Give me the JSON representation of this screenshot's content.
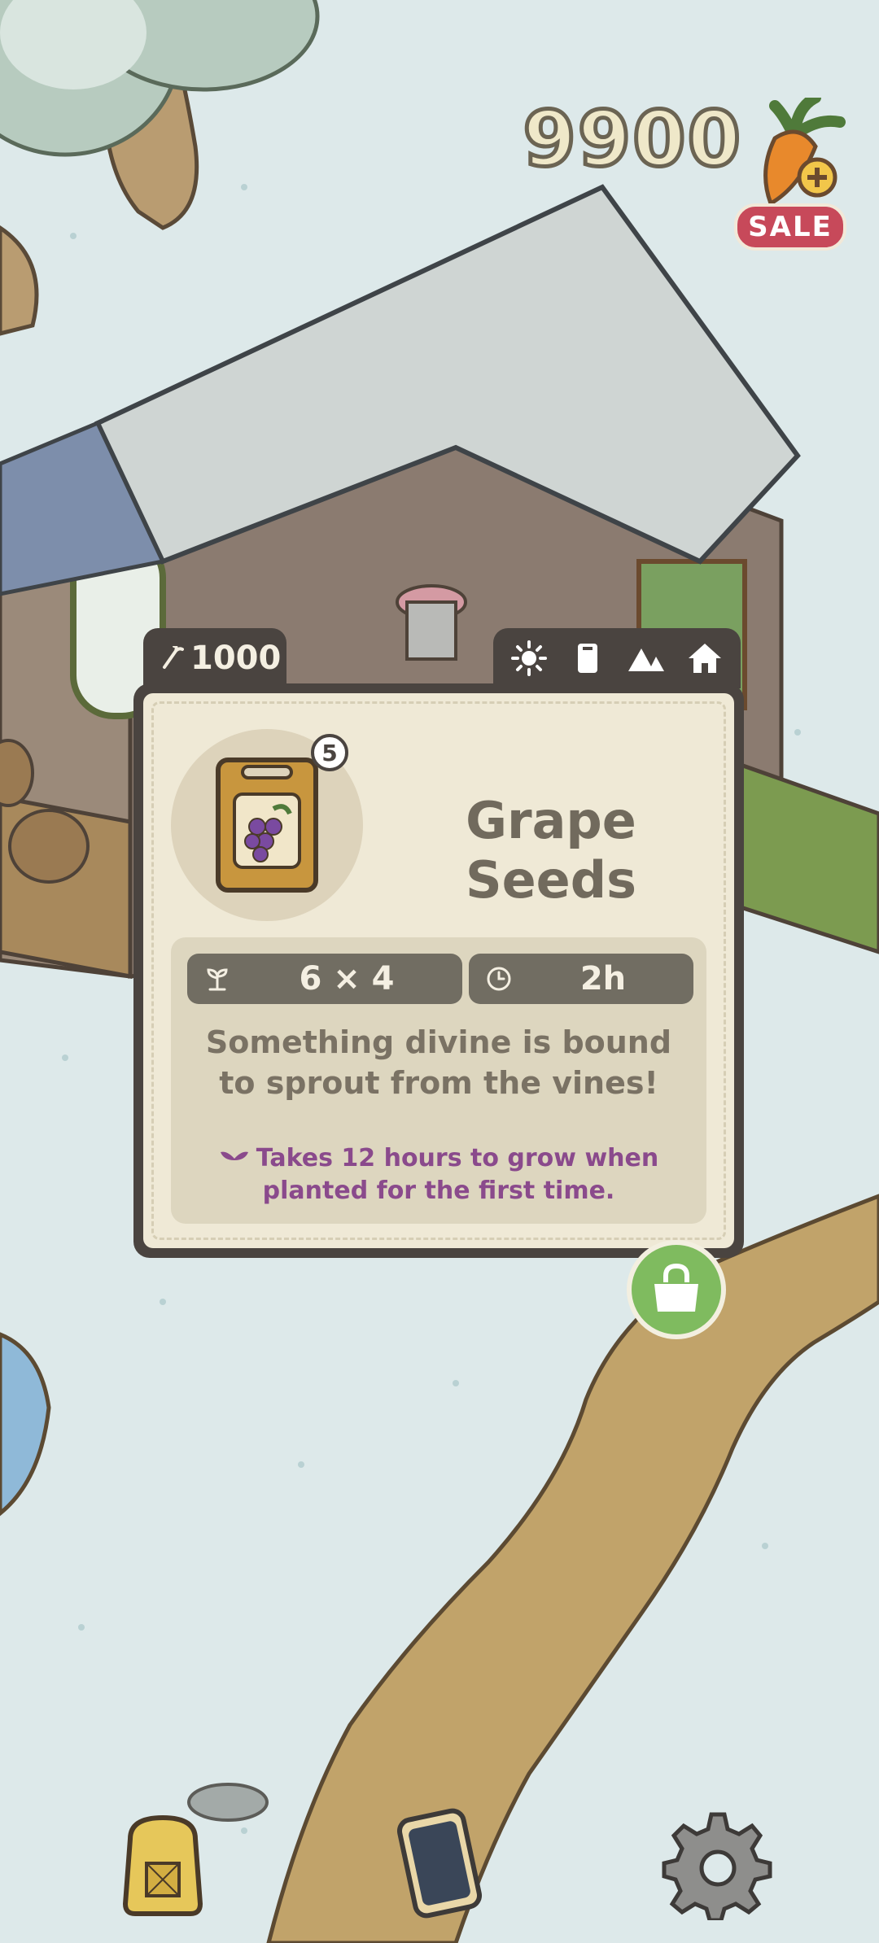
{
  "currency": {
    "amount": "9900",
    "sale_label": "SALE",
    "icon": "carrot-plus-icon"
  },
  "item_card": {
    "price": "1000",
    "price_icon": "carrot-small-icon",
    "season_icons": [
      "sun-icon",
      "seed-bag-icon",
      "mountain-icon",
      "house-icon"
    ],
    "quantity_badge": "5",
    "title": "Grape Seeds",
    "stats": {
      "size": "6 × 4",
      "time": "2h"
    },
    "description": "Something divine is bound to sprout from the vines!",
    "note": "Takes 12 hours to grow when planted for the first time."
  },
  "buttons": {
    "shop": "shopping-bag-icon",
    "backpack": "backpack-icon",
    "phone": "phone-icon",
    "settings": "gear-icon"
  },
  "colors": {
    "card_border": "#4a4440",
    "card_bg": "#efe9d6",
    "note_purple": "#8a4a8c",
    "shop_green": "#7fbb5f",
    "sale_red": "#c7495a"
  }
}
